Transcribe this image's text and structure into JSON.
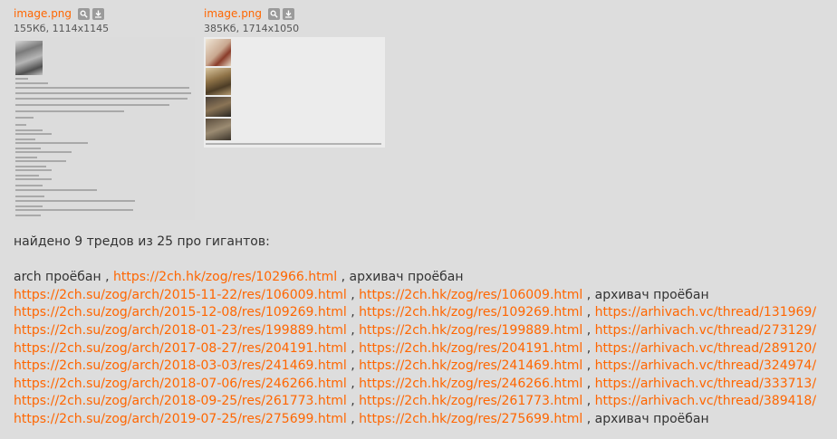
{
  "attachments": [
    {
      "name": "image.png",
      "meta": "155Кб, 1114x1145"
    },
    {
      "name": "image.png",
      "meta": "385Кб, 1714x1050"
    }
  ],
  "post": {
    "intro": "найдено 9 тредов из 25 про гигантов:",
    "separator": " , ",
    "rows": [
      {
        "cells": [
          {
            "text": "arch проёбан",
            "link": false
          },
          {
            "text": "https://2ch.hk/zog/res/102966.html",
            "link": true
          },
          {
            "text": "архивач проёбан",
            "link": false
          }
        ]
      },
      {
        "cells": [
          {
            "text": "https://2ch.su/zog/arch/2015-11-22/res/106009.html",
            "link": true
          },
          {
            "text": "https://2ch.hk/zog/res/106009.html",
            "link": true
          },
          {
            "text": "архивач проёбан",
            "link": false
          }
        ]
      },
      {
        "cells": [
          {
            "text": "https://2ch.su/zog/arch/2015-12-08/res/109269.html",
            "link": true
          },
          {
            "text": "https://2ch.hk/zog/res/109269.html",
            "link": true
          },
          {
            "text": "https://arhivach.vc/thread/131969/",
            "link": true
          }
        ]
      },
      {
        "cells": [
          {
            "text": "https://2ch.su/zog/arch/2018-01-23/res/199889.html",
            "link": true
          },
          {
            "text": "https://2ch.hk/zog/res/199889.html",
            "link": true
          },
          {
            "text": "https://arhivach.vc/thread/273129/",
            "link": true
          }
        ]
      },
      {
        "cells": [
          {
            "text": "https://2ch.su/zog/arch/2017-08-27/res/204191.html",
            "link": true
          },
          {
            "text": "https://2ch.hk/zog/res/204191.html",
            "link": true
          },
          {
            "text": "https://arhivach.vc/thread/289120/",
            "link": true
          }
        ]
      },
      {
        "cells": [
          {
            "text": "https://2ch.su/zog/arch/2018-03-03/res/241469.html",
            "link": true
          },
          {
            "text": "https://2ch.hk/zog/res/241469.html",
            "link": true
          },
          {
            "text": "https://arhivach.vc/thread/324974/",
            "link": true
          }
        ]
      },
      {
        "cells": [
          {
            "text": "https://2ch.su/zog/arch/2018-07-06/res/246266.html",
            "link": true
          },
          {
            "text": "https://2ch.hk/zog/res/246266.html",
            "link": true
          },
          {
            "text": "https://arhivach.vc/thread/333713/",
            "link": true
          }
        ]
      },
      {
        "cells": [
          {
            "text": "https://2ch.su/zog/arch/2018-09-25/res/261773.html",
            "link": true
          },
          {
            "text": "https://2ch.hk/zog/res/261773.html",
            "link": true
          },
          {
            "text": "https://arhivach.vc/thread/389418/",
            "link": true
          }
        ]
      },
      {
        "cells": [
          {
            "text": "https://2ch.su/zog/arch/2019-07-25/res/275699.html",
            "link": true
          },
          {
            "text": "https://2ch.hk/zog/res/275699.html",
            "link": true
          },
          {
            "text": "архивач проёбан",
            "link": false
          }
        ]
      }
    ]
  },
  "colors": {
    "link": "#ff6600",
    "text": "#333333",
    "background": "#dddddd"
  },
  "icons": {
    "search": "search-icon",
    "download": "download-icon"
  }
}
